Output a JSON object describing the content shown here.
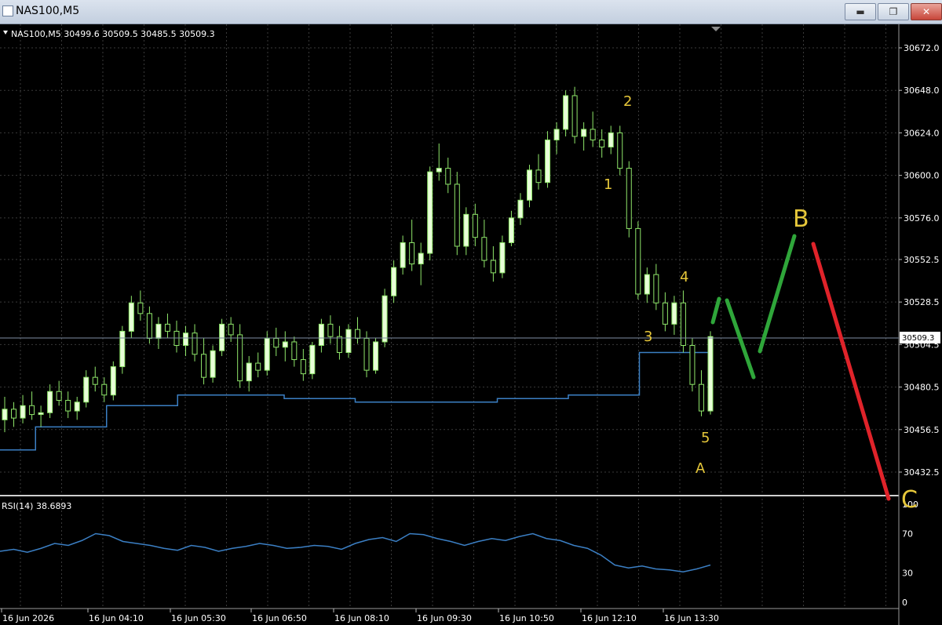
{
  "window": {
    "title": "NAS100,M5",
    "min_glyph": "▬",
    "max_glyph": "❐",
    "close_glyph": "✕"
  },
  "chart_header": {
    "symbol": "NAS100,M5",
    "open": "30499.6",
    "high": "30509.5",
    "low": "30485.5",
    "close": "30509.3",
    "text": "NAS100,M5  30499.6 30509.5 30485.5 30509.3"
  },
  "price_axis": {
    "ticks": [
      "30672.0",
      "30648.0",
      "30624.0",
      "30600.0",
      "30576.0",
      "30552.5",
      "30528.5",
      "30504.5",
      "30480.5",
      "30456.5",
      "30432.5"
    ],
    "current_price": "30509.3"
  },
  "rsi": {
    "header": "RSI(14) 38.6893",
    "ticks": [
      "100",
      "70",
      "30",
      "0"
    ]
  },
  "time_axis": {
    "ticks": [
      "16 Jun 2026",
      "16 Jun 04:10",
      "16 Jun 05:30",
      "16 Jun 06:50",
      "16 Jun 08:10",
      "16 Jun 09:30",
      "16 Jun 10:50",
      "16 Jun 12:10",
      "16 Jun 13:30"
    ]
  },
  "wave_labels": [
    "1",
    "2",
    "3",
    "4",
    "5",
    "A",
    "B",
    "C"
  ],
  "colors": {
    "background": "#000000",
    "grid": "#3a3a3a",
    "candle": "#8fe66a",
    "candle_body_up": "#e8ffd8",
    "ma_line": "#3b7fc4",
    "rsi_line": "#3b7fc4",
    "wave_label": "#e6c73a",
    "projection_up": "#2fa63a",
    "projection_down": "#e0232a"
  },
  "chart_data": {
    "type": "candlestick",
    "symbol": "NAS100",
    "timeframe": "M5",
    "ylim": [
      30425,
      30680
    ],
    "candles": [
      [
        30462,
        30475,
        30455,
        30468
      ],
      [
        30468,
        30472,
        30458,
        30463
      ],
      [
        30463,
        30476,
        30460,
        30470
      ],
      [
        30470,
        30478,
        30462,
        30465
      ],
      [
        30465,
        30470,
        30458,
        30466
      ],
      [
        30466,
        30482,
        30463,
        30478
      ],
      [
        30478,
        30484,
        30470,
        30473
      ],
      [
        30473,
        30478,
        30463,
        30467
      ],
      [
        30467,
        30475,
        30462,
        30472
      ],
      [
        30472,
        30490,
        30469,
        30486
      ],
      [
        30486,
        30492,
        30478,
        30482
      ],
      [
        30482,
        30486,
        30472,
        30476
      ],
      [
        30476,
        30495,
        30473,
        30492
      ],
      [
        30492,
        30515,
        30488,
        30512
      ],
      [
        30512,
        30532,
        30508,
        30528
      ],
      [
        30528,
        30535,
        30518,
        30522
      ],
      [
        30522,
        30526,
        30505,
        30508
      ],
      [
        30508,
        30520,
        30502,
        30516
      ],
      [
        30516,
        30522,
        30508,
        30512
      ],
      [
        30512,
        30518,
        30500,
        30504
      ],
      [
        30504,
        30515,
        30498,
        30511
      ],
      [
        30511,
        30516,
        30495,
        30499
      ],
      [
        30499,
        30508,
        30482,
        30486
      ],
      [
        30486,
        30504,
        30483,
        30501
      ],
      [
        30501,
        30519,
        30498,
        30516
      ],
      [
        30516,
        30520,
        30506,
        30510
      ],
      [
        30510,
        30516,
        30480,
        30484
      ],
      [
        30484,
        30498,
        30478,
        30494
      ],
      [
        30494,
        30500,
        30486,
        30490
      ],
      [
        30490,
        30512,
        30487,
        30508
      ],
      [
        30508,
        30514,
        30498,
        30503
      ],
      [
        30503,
        30512,
        30495,
        30506
      ],
      [
        30506,
        30509,
        30492,
        30496
      ],
      [
        30496,
        30502,
        30484,
        30488
      ],
      [
        30488,
        30506,
        30485,
        30504
      ],
      [
        30504,
        30519,
        30500,
        30516
      ],
      [
        30516,
        30521,
        30505,
        30509
      ],
      [
        30509,
        30515,
        30496,
        30500
      ],
      [
        30500,
        30516,
        30497,
        30513
      ],
      [
        30513,
        30520,
        30505,
        30508
      ],
      [
        30508,
        30512,
        30486,
        30490
      ],
      [
        30490,
        30508,
        30488,
        30506
      ],
      [
        30506,
        30536,
        30503,
        30532
      ],
      [
        30532,
        30552,
        30528,
        30548
      ],
      [
        30548,
        30566,
        30544,
        30562
      ],
      [
        30562,
        30575,
        30546,
        30550
      ],
      [
        30550,
        30562,
        30538,
        30556
      ],
      [
        30556,
        30605,
        30552,
        30602
      ],
      [
        30602,
        30618,
        30597,
        30604
      ],
      [
        30604,
        30610,
        30590,
        30595
      ],
      [
        30595,
        30602,
        30555,
        30560
      ],
      [
        30560,
        30582,
        30555,
        30578
      ],
      [
        30578,
        30584,
        30560,
        30565
      ],
      [
        30565,
        30575,
        30548,
        30552
      ],
      [
        30552,
        30560,
        30540,
        30545
      ],
      [
        30545,
        30566,
        30542,
        30562
      ],
      [
        30562,
        30580,
        30560,
        30576
      ],
      [
        30576,
        30590,
        30572,
        30586
      ],
      [
        30586,
        30606,
        30582,
        30603
      ],
      [
        30603,
        30612,
        30592,
        30596
      ],
      [
        30596,
        30625,
        30593,
        30620
      ],
      [
        30620,
        30630,
        30612,
        30626
      ],
      [
        30626,
        30648,
        30622,
        30645
      ],
      [
        30645,
        30650,
        30618,
        30622
      ],
      [
        30622,
        30630,
        30614,
        30626
      ],
      [
        30626,
        30636,
        30616,
        30620
      ],
      [
        30620,
        30626,
        30610,
        30616
      ],
      [
        30616,
        30628,
        30612,
        30624
      ],
      [
        30624,
        30628,
        30600,
        30604
      ],
      [
        30604,
        30608,
        30565,
        30570
      ],
      [
        30570,
        30574,
        30530,
        30533
      ],
      [
        30533,
        30548,
        30528,
        30544
      ],
      [
        30544,
        30550,
        30524,
        30528
      ],
      [
        30528,
        30534,
        30512,
        30516
      ],
      [
        30516,
        30532,
        30510,
        30528
      ],
      [
        30528,
        30535,
        30500,
        30504
      ],
      [
        30504,
        30508,
        30478,
        30482
      ],
      [
        30482,
        30490,
        30464,
        30467
      ],
      [
        30467,
        30512,
        30465,
        30509
      ]
    ],
    "ma_line": [
      30445,
      30458,
      30458,
      30470,
      30470,
      30476,
      30476,
      30476,
      30474,
      30474,
      30472,
      30472,
      30472,
      30472,
      30474,
      30474,
      30476,
      30476,
      30500,
      30500
    ],
    "rsi_values": [
      52,
      54,
      51,
      55,
      60,
      58,
      63,
      70,
      68,
      62,
      60,
      58,
      55,
      53,
      58,
      56,
      52,
      55,
      57,
      60,
      58,
      55,
      56,
      58,
      57,
      54,
      60,
      64,
      66,
      62,
      70,
      69,
      65,
      62,
      58,
      62,
      65,
      63,
      67,
      70,
      65,
      63,
      58,
      55,
      48,
      38,
      35,
      37,
      34,
      33,
      31,
      34,
      38
    ],
    "projection": {
      "wave_a_low": 30467,
      "wave_b_high": 30568,
      "wave_c_target": 30428
    }
  }
}
